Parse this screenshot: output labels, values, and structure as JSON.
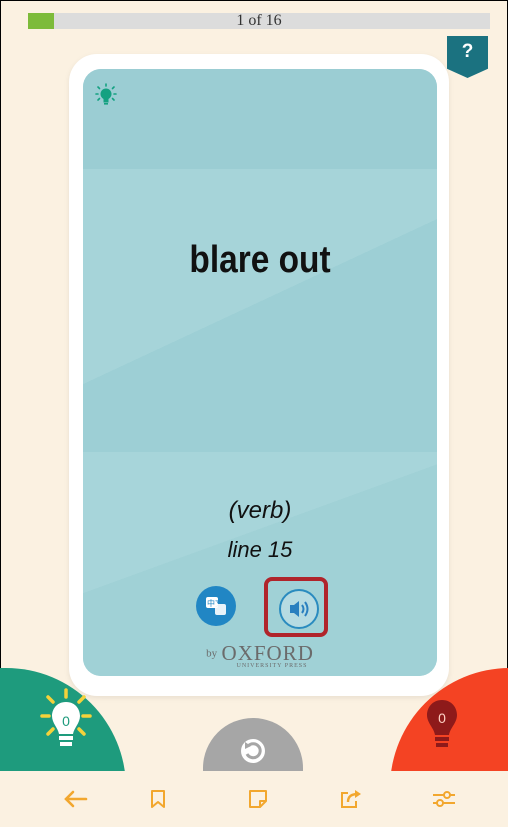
{
  "progress": {
    "text": "1 of 16",
    "current": 1,
    "total": 16
  },
  "help": {
    "label": "?"
  },
  "card": {
    "word": "blare out",
    "part_of_speech": "(verb)",
    "line_ref": "line 15",
    "translate_label": "中文",
    "publisher_by": "by",
    "publisher": "OXFORD",
    "publisher_sub": "UNIVERSITY PRESS"
  },
  "known": {
    "count": "0"
  },
  "unknown": {
    "count": "0"
  },
  "toolbar": {
    "icons": [
      "back-arrow-icon",
      "bookmark-icon",
      "note-icon",
      "share-icon",
      "settings-sliders-icon"
    ]
  },
  "colors": {
    "accent_orange": "#f2a72e",
    "teal": "#1e9b7d",
    "red": "#f44323",
    "card": "#a0d0d6",
    "help": "#1b7280"
  }
}
